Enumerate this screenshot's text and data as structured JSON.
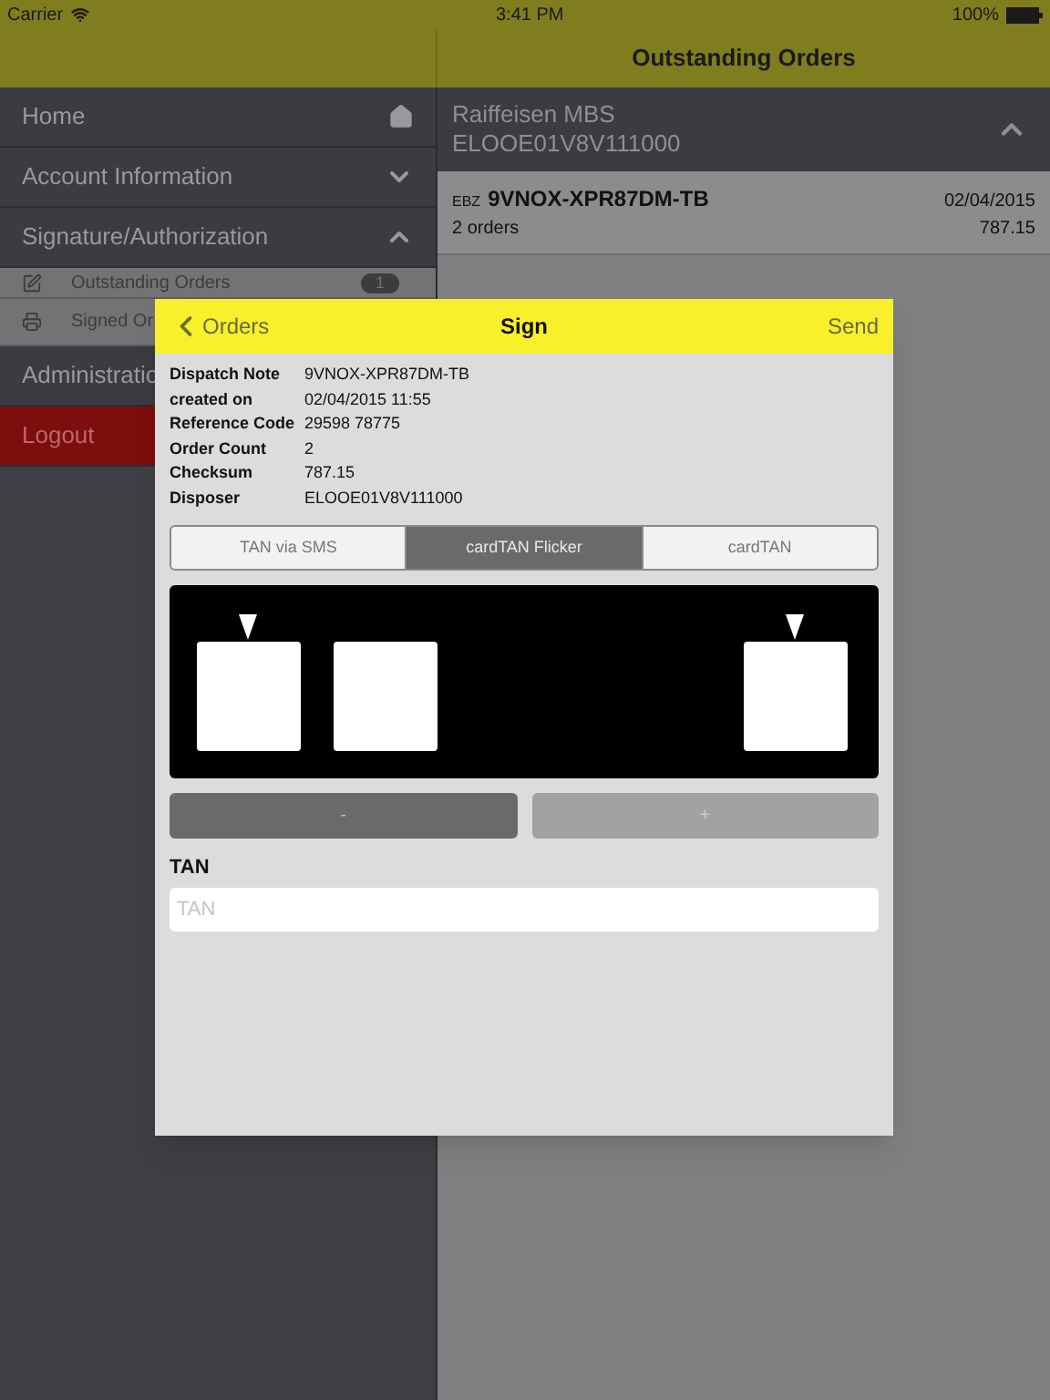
{
  "status_bar": {
    "carrier": "Carrier",
    "time": "3:41 PM",
    "battery": "100%"
  },
  "nav_title": "Outstanding Orders",
  "sidebar": {
    "items": [
      {
        "kind": "link",
        "label": "Home"
      },
      {
        "kind": "group",
        "label": "Account Information",
        "expanded": false
      },
      {
        "kind": "group",
        "label": "Signature/Authorization",
        "expanded": true,
        "children": [
          {
            "label": "Outstanding Orders",
            "badge": "1",
            "kind": "pending"
          },
          {
            "label": "Signed Or",
            "kind": "signed"
          }
        ]
      },
      {
        "kind": "plain",
        "label": "Administratio"
      },
      {
        "kind": "logout",
        "label": "Logout"
      }
    ]
  },
  "account": {
    "name": "Raiffeisen MBS",
    "number": "ELOOE01V8V111000",
    "expanded": true
  },
  "orders": [
    {
      "prefix": "EBZ",
      "id": "9VNOX-XPR87DM-TB",
      "date": "02/04/2015",
      "count": "2 orders",
      "amount": "787.15"
    }
  ],
  "modal": {
    "back": "Orders",
    "title": "Sign",
    "action": "Send",
    "details": [
      {
        "label": "Dispatch Note",
        "value": "9VNOX-XPR87DM-TB"
      },
      {
        "label": "created on",
        "value": "02/04/2015 11:55"
      },
      {
        "label": "Reference Code",
        "value": "29598 78775"
      },
      {
        "label": "Order Count",
        "value": "2"
      },
      {
        "label": "Checksum",
        "value": "787.15"
      },
      {
        "label": "Disposer",
        "value": "ELOOE01V8V111000"
      }
    ],
    "tabs": [
      {
        "label": "TAN via SMS",
        "selected": false
      },
      {
        "label": "cardTAN Flicker",
        "selected": true
      },
      {
        "label": "cardTAN",
        "selected": false
      }
    ],
    "buttons": [
      {
        "label": "-",
        "disabled": false
      },
      {
        "label": "+",
        "disabled": true
      }
    ],
    "tan": {
      "label": "TAN",
      "placeholder": "TAN"
    }
  }
}
